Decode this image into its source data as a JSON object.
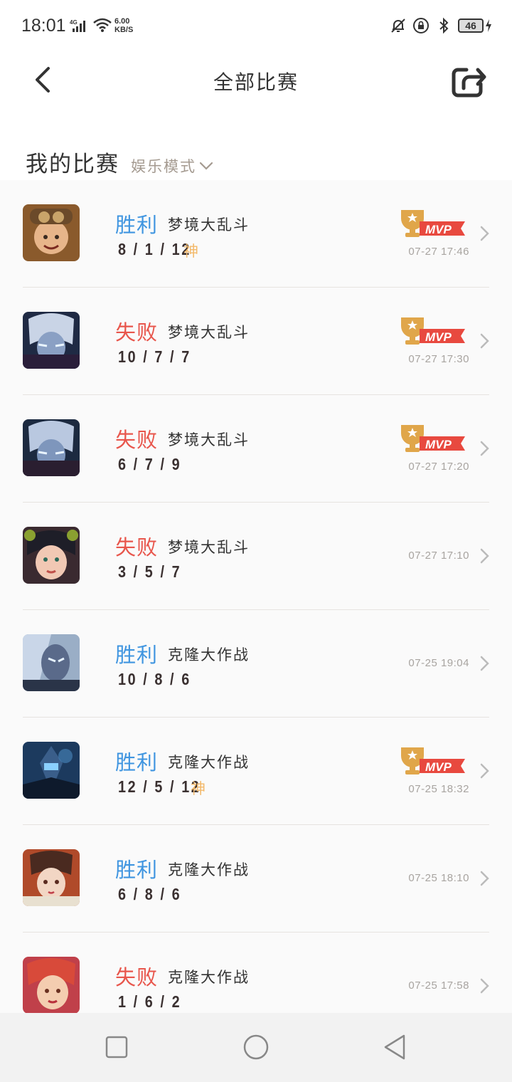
{
  "status_bar": {
    "time": "18:01",
    "network": "4G",
    "speed_value": "6.00",
    "speed_unit": "KB/S",
    "battery": "46"
  },
  "header": {
    "title": "全部比赛",
    "back_icon": "chevron-left-icon",
    "share_icon": "share-icon"
  },
  "section": {
    "title": "我的比赛",
    "mode_filter": "娱乐模式"
  },
  "colors": {
    "win": "#3f95e0",
    "loss": "#e8564c",
    "god": "#f3b96a",
    "mvp": "#e8564c"
  },
  "matches": [
    {
      "result": "胜利",
      "outcome": "win",
      "mode": "梦境大乱斗",
      "kda": "8 / 1 / 12",
      "god": "神",
      "mvp": "MVP",
      "time": "07-27 17:46"
    },
    {
      "result": "失败",
      "outcome": "loss",
      "mode": "梦境大乱斗",
      "kda": "10 / 7 / 7",
      "god": "",
      "mvp": "MVP",
      "time": "07-27 17:30"
    },
    {
      "result": "失败",
      "outcome": "loss",
      "mode": "梦境大乱斗",
      "kda": "6 / 7 / 9",
      "god": "",
      "mvp": "MVP",
      "time": "07-27 17:20"
    },
    {
      "result": "失败",
      "outcome": "loss",
      "mode": "梦境大乱斗",
      "kda": "3 / 5 / 7",
      "god": "",
      "mvp": "",
      "time": "07-27 17:10"
    },
    {
      "result": "胜利",
      "outcome": "win",
      "mode": "克隆大作战",
      "kda": "10 / 8 / 6",
      "god": "",
      "mvp": "",
      "time": "07-25 19:04"
    },
    {
      "result": "胜利",
      "outcome": "win",
      "mode": "克隆大作战",
      "kda": "12 / 5 / 12",
      "god": "神",
      "mvp": "MVP",
      "time": "07-25 18:32"
    },
    {
      "result": "胜利",
      "outcome": "win",
      "mode": "克隆大作战",
      "kda": "6 / 8 / 6",
      "god": "",
      "mvp": "",
      "time": "07-25 18:10"
    },
    {
      "result": "失败",
      "outcome": "loss",
      "mode": "克隆大作战",
      "kda": "1 / 6 / 2",
      "god": "",
      "mvp": "",
      "time": "07-25 17:58"
    }
  ],
  "nav": {
    "recents_icon": "square-icon",
    "home_icon": "circle-icon",
    "back_icon": "triangle-back-icon"
  }
}
